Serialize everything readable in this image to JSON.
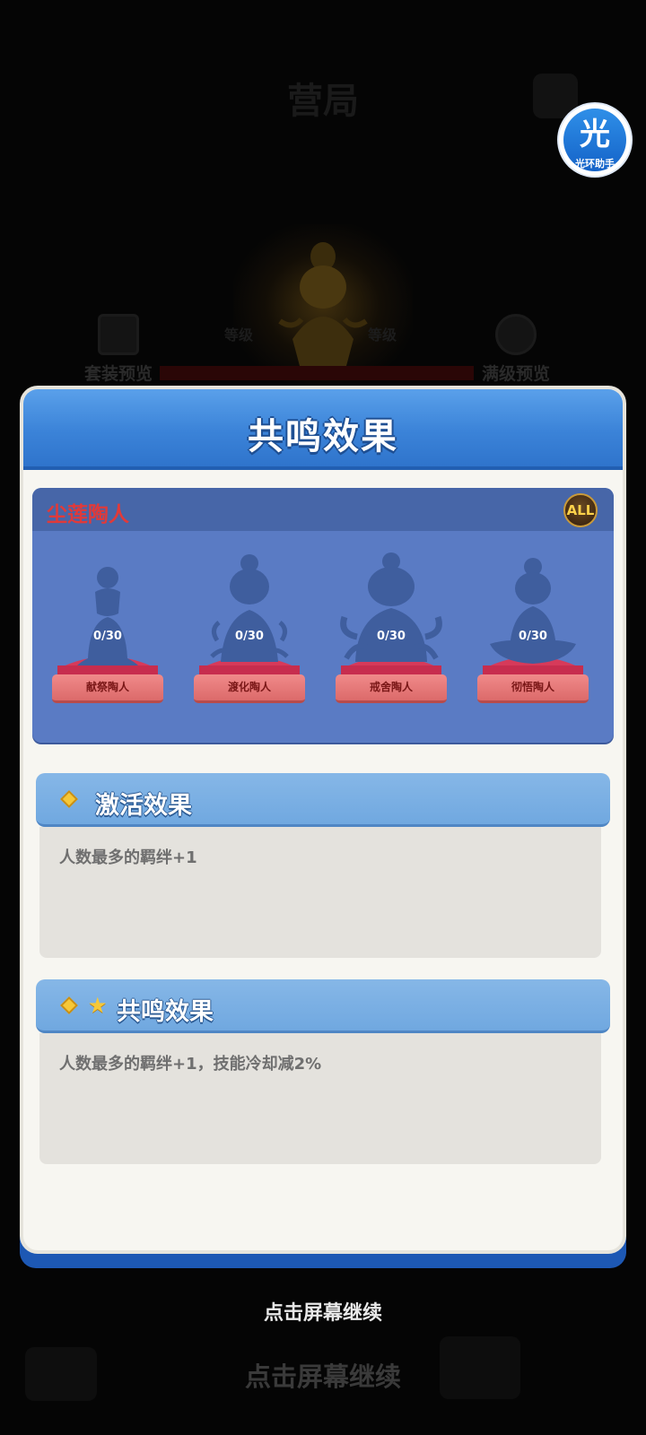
{
  "background": {
    "title": "营局",
    "left_button": "套装预览",
    "right_button": "满级预览",
    "continue_echo": "点击屏幕继续"
  },
  "assistant": {
    "glyph": "光",
    "label": "光环助手"
  },
  "panel": {
    "title": "共鸣效果",
    "collection": {
      "name": "尘莲陶人",
      "all_label": "ALL",
      "figures": [
        {
          "count": "0/30",
          "name": "献祭陶人"
        },
        {
          "count": "0/30",
          "name": "渡化陶人"
        },
        {
          "count": "0/30",
          "name": "戒舍陶人"
        },
        {
          "count": "0/30",
          "name": "彻悟陶人"
        }
      ]
    },
    "activation": {
      "title": "激活效果",
      "text": "人数最多的羁绊+1"
    },
    "resonance": {
      "title": "共鸣效果",
      "text": "人数最多的羁绊+1，技能冷却减2%"
    }
  },
  "continue_prompt": "点击屏幕继续",
  "colors": {
    "header_blue": "#3b83d8",
    "card_blue": "#5a7bc4",
    "collection_name_red": "#e03a3a",
    "plate_pink": "#e27272",
    "panel_bg": "#f7f6f1",
    "section_blue": "#78ade3"
  }
}
